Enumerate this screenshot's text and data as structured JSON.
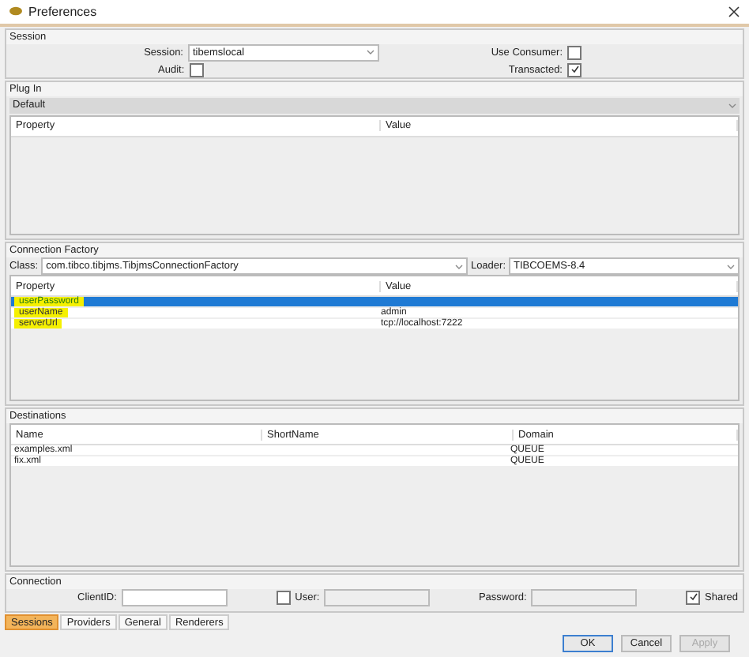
{
  "window": {
    "title": "Preferences"
  },
  "session": {
    "title": "Session",
    "session_label": "Session:",
    "session_value": "tibemslocal",
    "audit_label": "Audit:",
    "audit_checked": false,
    "use_consumer_label": "Use Consumer:",
    "use_consumer_checked": false,
    "transacted_label": "Transacted:",
    "transacted_checked": true
  },
  "plugin": {
    "title": "Plug In",
    "selector": "Default",
    "columns": [
      "Property",
      "Value"
    ]
  },
  "connection_factory": {
    "title": "Connection Factory",
    "class_label": "Class:",
    "class_value": "com.tibco.tibjms.TibjmsConnectionFactory",
    "loader_label": "Loader:",
    "loader_value": "TIBCOEMS-8.4",
    "columns": [
      "Property",
      "Value"
    ],
    "rows": [
      {
        "property": "userPassword",
        "value": "",
        "selected": true,
        "highlighted": true
      },
      {
        "property": "userName",
        "value": "admin",
        "selected": false,
        "highlighted": true
      },
      {
        "property": "serverUrl",
        "value": "tcp://localhost:7222",
        "selected": false,
        "highlighted": true
      }
    ]
  },
  "destinations": {
    "title": "Destinations",
    "columns": [
      "Name",
      "ShortName",
      "Domain"
    ],
    "rows": [
      [
        "examples.xml",
        "",
        "QUEUE"
      ],
      [
        "fix.xml",
        "",
        "QUEUE"
      ]
    ]
  },
  "connection": {
    "title": "Connection",
    "client_id_label": "ClientID:",
    "user_label": "User:",
    "user_checked": false,
    "password_label": "Password:",
    "shared_label": "Shared",
    "shared_checked": true
  },
  "tabs": [
    {
      "label": "Sessions",
      "selected": true
    },
    {
      "label": "Providers",
      "selected": false
    },
    {
      "label": "General",
      "selected": false
    },
    {
      "label": "Renderers",
      "selected": false
    }
  ],
  "buttons": [
    {
      "label": "OK",
      "disabled": false,
      "default": true
    },
    {
      "label": "Cancel",
      "disabled": false,
      "default": false
    },
    {
      "label": "Apply",
      "disabled": true,
      "default": false
    }
  ]
}
